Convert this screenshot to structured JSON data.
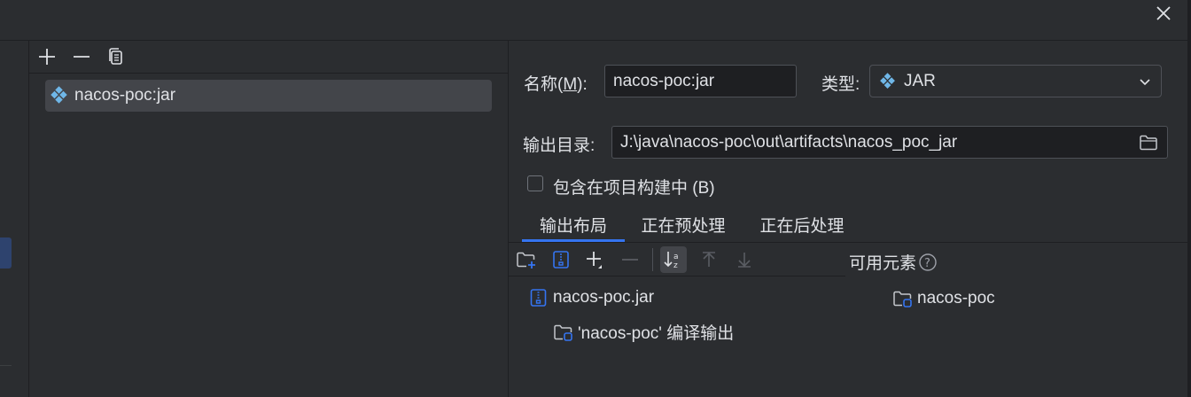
{
  "toolbar": {
    "add_icon": "plus-icon",
    "remove_icon": "minus-icon",
    "copy_icon": "copy-icon"
  },
  "artifacts": [
    {
      "name": "nacos-poc:jar"
    }
  ],
  "form": {
    "name_label": "名称(M):",
    "name_label_prefix": "名称(",
    "name_label_mnemonic": "M",
    "name_label_suffix": "):",
    "name_value": "nacos-poc:jar",
    "type_label": "类型:",
    "type_value": "JAR",
    "output_dir_label": "输出目录:",
    "output_dir_value": "J:\\java\\nacos-poc\\out\\artifacts\\nacos_poc_jar",
    "include_in_build_label": "包含在项目构建中 (B)",
    "include_in_build_checked": false
  },
  "tabs": [
    {
      "label": "输出布局",
      "active": true
    },
    {
      "label": "正在预处理",
      "active": false
    },
    {
      "label": "正在后处理",
      "active": false
    }
  ],
  "layout": {
    "available_label": "可用元素",
    "tree": [
      {
        "label": "nacos-poc.jar",
        "icon": "archive-icon"
      },
      {
        "label": "'nacos-poc' 编译输出",
        "icon": "module-folder-icon"
      }
    ],
    "available": [
      {
        "label": "nacos-poc",
        "icon": "module-folder-icon"
      }
    ]
  },
  "colors": {
    "accent": "#3574f0",
    "background": "#2b2d30",
    "input_bg": "#1e1f22",
    "selection": "#43454a"
  }
}
